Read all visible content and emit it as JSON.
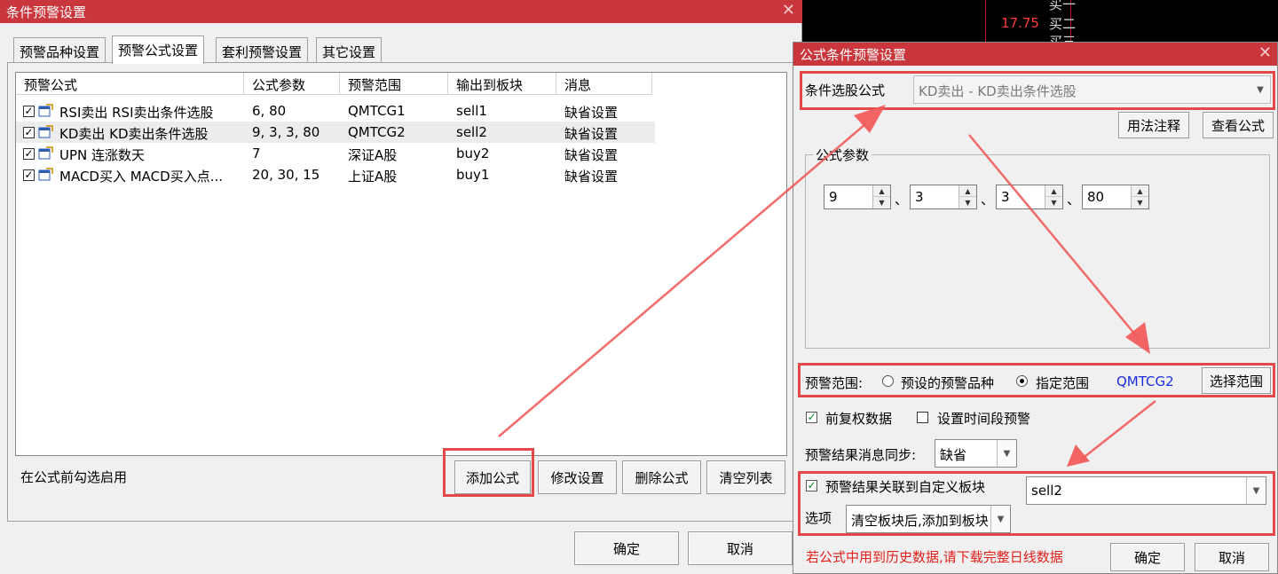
{
  "left_dialog": {
    "title": "条件预警设置",
    "close": "✕",
    "tabs": [
      "预警品种设置",
      "预警公式设置",
      "套利预警设置",
      "其它设置"
    ],
    "columns": [
      "预警公式",
      "公式参数",
      "预警范围",
      "输出到板块",
      "消息"
    ],
    "rows": [
      {
        "formula": "RSI卖出 RSI卖出条件选股",
        "params": "6, 80",
        "range": "QMTCG1",
        "block": "sell1",
        "message": "缺省设置"
      },
      {
        "formula": "KD卖出 KD卖出条件选股",
        "params": "9, 3, 3, 80",
        "range": "QMTCG2",
        "block": "sell2",
        "message": "缺省设置"
      },
      {
        "formula": "UPN 连涨数天",
        "params": "7",
        "range": "深证A股",
        "block": "buy2",
        "message": "缺省设置"
      },
      {
        "formula": "MACD买入 MACD买入点...",
        "params": "20, 30, 15",
        "range": "上证A股",
        "block": "buy1",
        "message": "缺省设置"
      }
    ],
    "hint": "在公式前勾选启用",
    "buttons": {
      "add": "添加公式",
      "modify": "修改设置",
      "delete": "删除公式",
      "clear": "清空列表"
    },
    "ok": "确定",
    "cancel": "取消"
  },
  "chart_strip": {
    "price": "17.75",
    "labels": [
      "买一",
      "买二",
      "买三"
    ]
  },
  "right_dialog": {
    "title": "公式条件预警设置",
    "close": "✕",
    "formula_label": "条件选股公式",
    "formula_value": "KD卖出  -  KD卖出条件选股",
    "usage_button": "用法注释",
    "view_button": "查看公式",
    "params_group": "公式参数",
    "params": [
      "9",
      "3",
      "3",
      "80"
    ],
    "separator": "、",
    "range_label": "预警范围:",
    "range_option1": "预设的预警品种",
    "range_option2": "指定范围",
    "range_value": "QMTCG2",
    "choose_range_button": "选择范围",
    "adjusted_label": "前复权数据",
    "adjusted_checked": true,
    "timeslot_label": "设置时间段预警",
    "timeslot_checked": false,
    "sync_label": "预警结果消息同步:",
    "sync_value": "缺省",
    "link_label": "预警结果关联到自定义板块",
    "link_checked": true,
    "link_block": "sell2",
    "option_label": "选项",
    "option_value": "清空板块后,添加到板块",
    "warning": "若公式中用到历史数据,请下载完整日线数据",
    "ok": "确定",
    "cancel": "取消"
  },
  "colors": {
    "titlebar": "#c9363b",
    "highlight": "#e34948",
    "link_blue": "#1a2ee0",
    "warning_red": "#e0201b"
  }
}
